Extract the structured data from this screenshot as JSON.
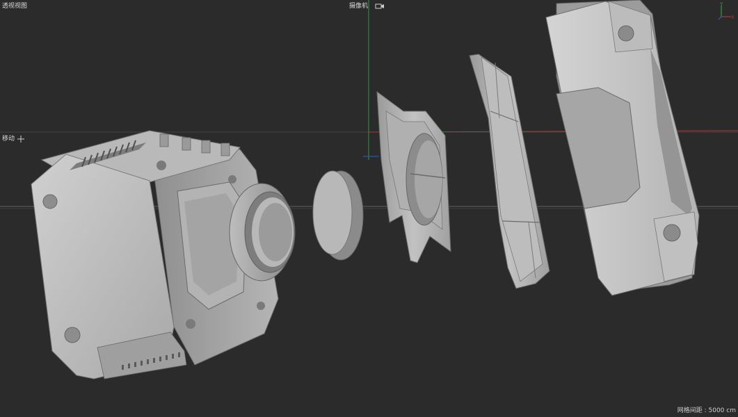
{
  "viewport": {
    "view_name": "透视视图",
    "camera_label": "摄像机",
    "tool_label": "移动",
    "grid_spacing": "网格间距 : 5000 cm",
    "icons": [
      "camera-icon",
      "move-icon",
      "axis-gizmo-icon"
    ],
    "axis_labels": {
      "y": "Y",
      "x": "X"
    }
  },
  "colors": {
    "background": "#2b2b2b",
    "grid_line": "#4a4a4a",
    "axis_x": "#b83232",
    "axis_y": "#2f9e3a",
    "axis_z": "#2d5fc2",
    "model_light": "#c8c8c8",
    "model_mid": "#9e9e9e",
    "model_dark": "#5e5e5e"
  }
}
